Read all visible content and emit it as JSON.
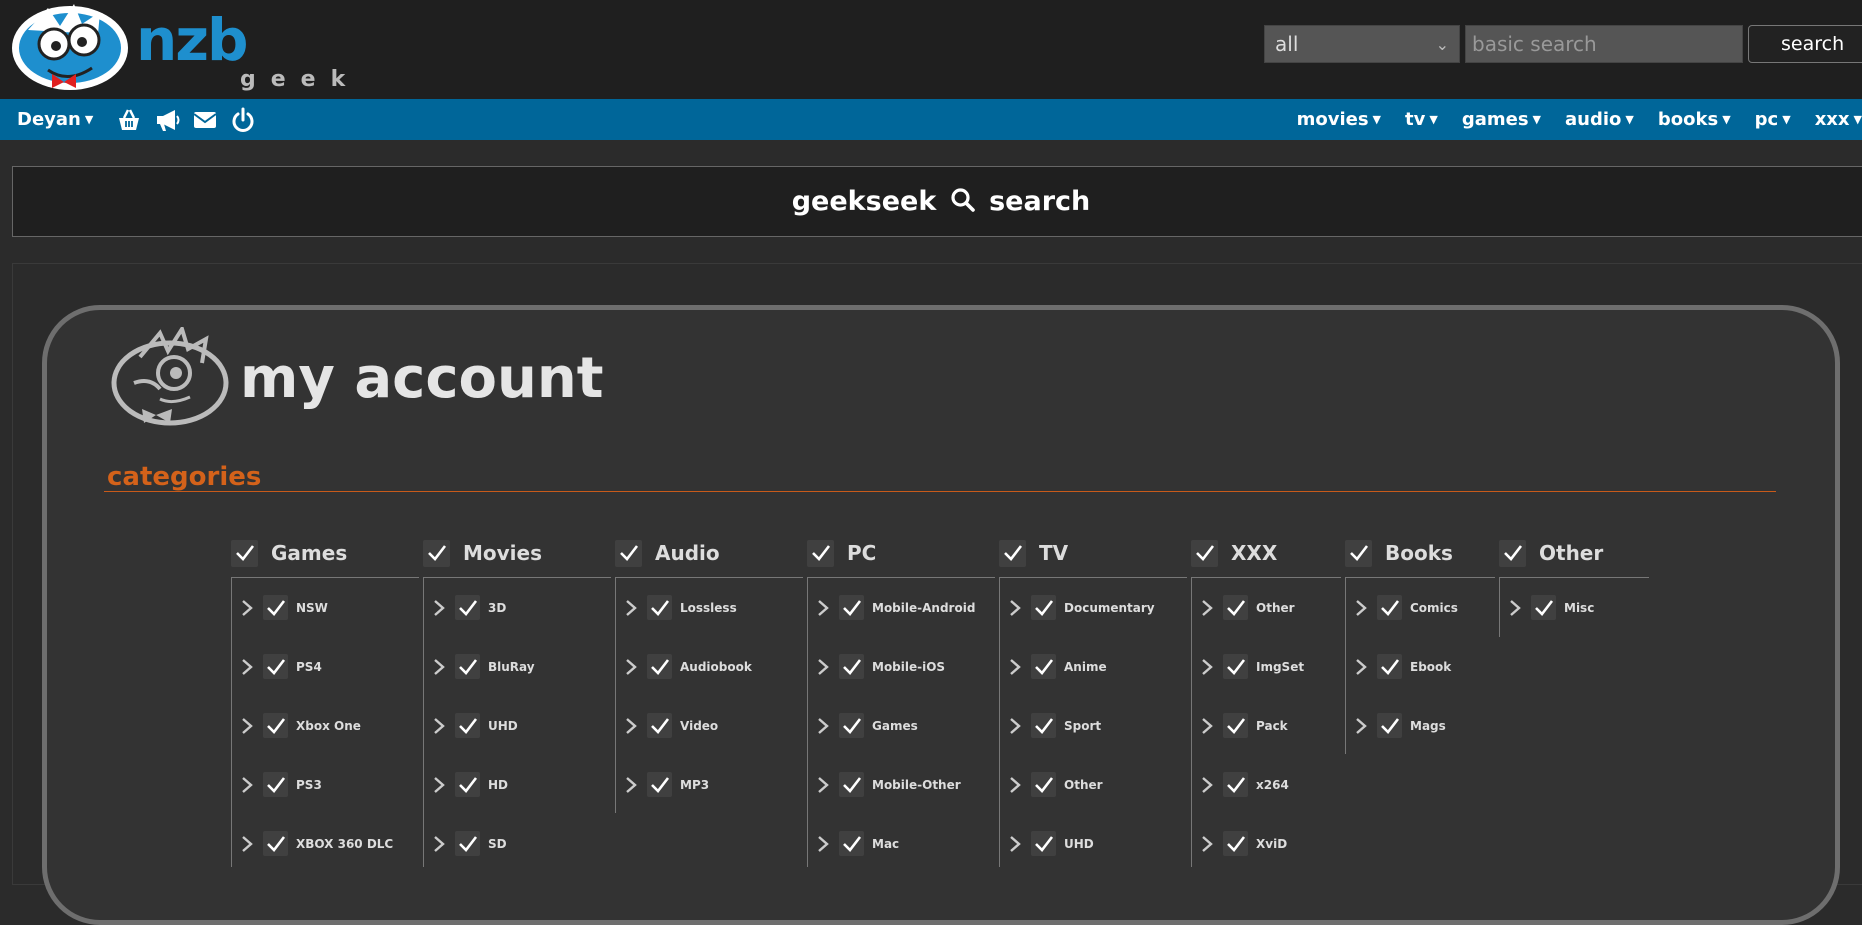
{
  "header": {
    "logo_text": "nzb geek",
    "search": {
      "category_value": "all",
      "placeholder": "basic search",
      "button_label": "search"
    }
  },
  "nav": {
    "user": "Deyan",
    "icons": [
      "basket-icon",
      "megaphone-icon",
      "envelope-icon",
      "power-icon"
    ],
    "menu": [
      "movies",
      "tv",
      "games",
      "audio",
      "books",
      "pc",
      "xxx"
    ]
  },
  "banner": {
    "left": "geekseek",
    "right": "search"
  },
  "account": {
    "title": "my account",
    "section": "categories"
  },
  "categories": [
    {
      "name": "Games",
      "items": [
        "NSW",
        "PS4",
        "Xbox One",
        "PS3",
        "XBOX 360 DLC"
      ]
    },
    {
      "name": "Movies",
      "items": [
        "3D",
        "BluRay",
        "UHD",
        "HD",
        "SD"
      ]
    },
    {
      "name": "Audio",
      "items": [
        "Lossless",
        "Audiobook",
        "Video",
        "MP3"
      ]
    },
    {
      "name": "PC",
      "items": [
        "Mobile-Android",
        "Mobile-iOS",
        "Games",
        "Mobile-Other",
        "Mac"
      ]
    },
    {
      "name": "TV",
      "items": [
        "Documentary",
        "Anime",
        "Sport",
        "Other",
        "UHD"
      ]
    },
    {
      "name": "XXX",
      "items": [
        "Other",
        "ImgSet",
        "Pack",
        "x264",
        "XviD"
      ]
    },
    {
      "name": "Books",
      "items": [
        "Comics",
        "Ebook",
        "Mags"
      ]
    },
    {
      "name": "Other",
      "items": [
        "Misc"
      ]
    }
  ],
  "colors": {
    "header_bg": "#1f1f1f",
    "nav_bg": "#006699",
    "accent_orange": "#d4621a",
    "panel_bg": "#333333"
  }
}
